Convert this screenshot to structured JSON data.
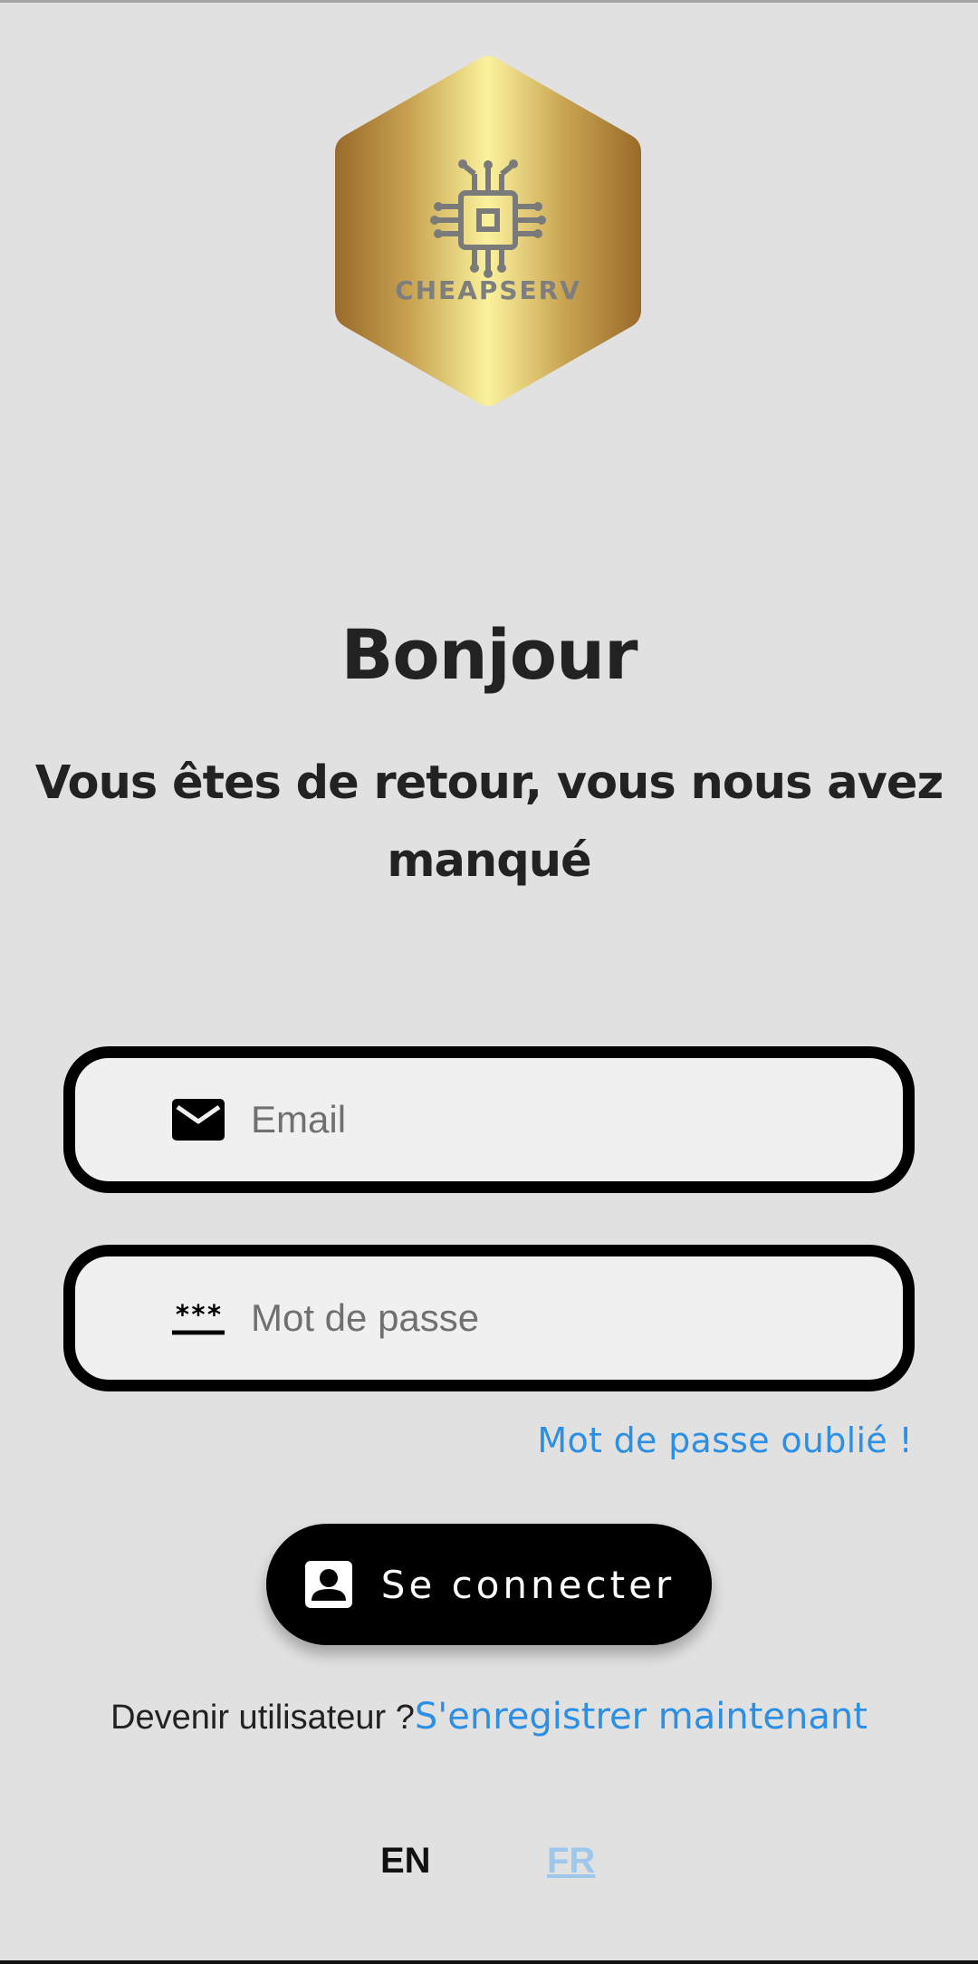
{
  "logo": {
    "text": "CHEAPSERV",
    "icon": "circuit-chip-icon",
    "colors": {
      "gold_light": "#fbf29d",
      "gold_dark": "#9a6a2a",
      "text": "#8a8a8a"
    }
  },
  "greeting": "Bonjour",
  "subtitle": "Vous êtes de retour, vous nous avez manqué",
  "form": {
    "email": {
      "placeholder": "Email",
      "value": "",
      "icon": "mail-icon"
    },
    "password": {
      "placeholder": "Mot de passe",
      "value": "",
      "icon": "password-asterisk-icon"
    },
    "forgot_password": "Mot de passe oublié !",
    "submit": {
      "label": "Se connecter",
      "icon": "account-box-icon"
    }
  },
  "register": {
    "prompt": "Devenir utilisateur ?",
    "link": "S'enregistrer maintenant"
  },
  "language": {
    "en": "EN",
    "fr": "FR",
    "selected": "FR"
  },
  "colors": {
    "background": "#e1e1e1",
    "link": "#2d8fe3",
    "button": "#000000",
    "selected_language": "#9dc8ec"
  }
}
